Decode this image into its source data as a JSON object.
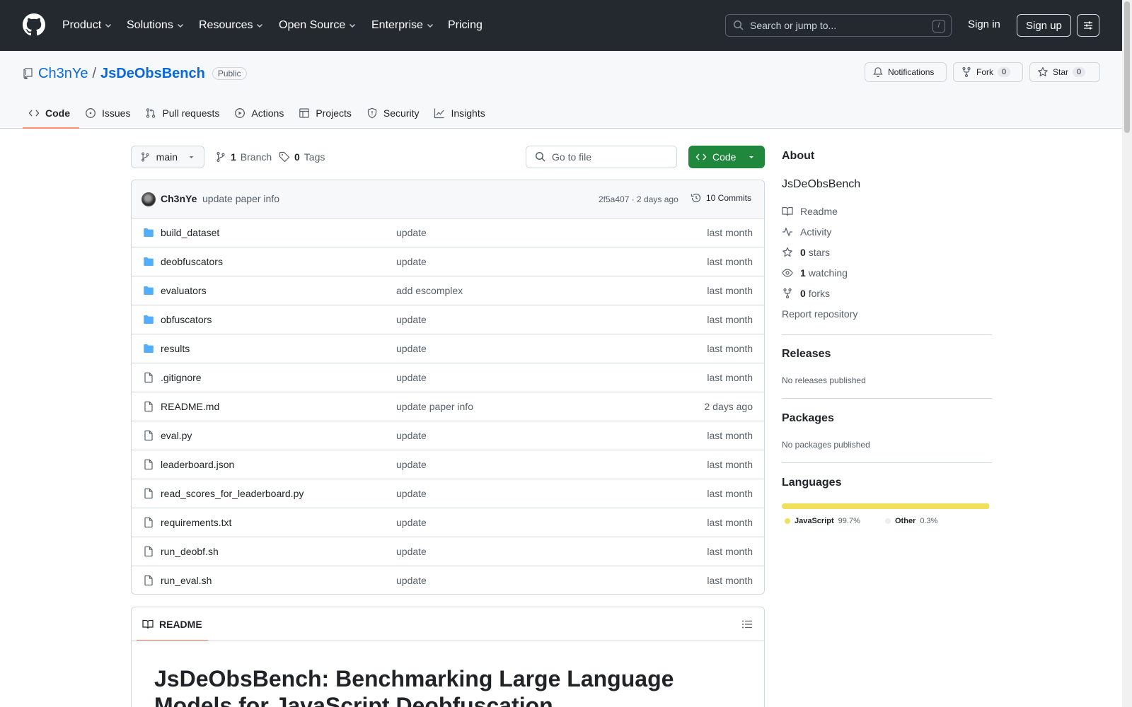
{
  "header": {
    "nav": [
      "Product",
      "Solutions",
      "Resources",
      "Open Source",
      "Enterprise",
      "Pricing"
    ],
    "search_placeholder": "Search or jump to...",
    "search_shortcut": "/",
    "sign_in": "Sign in",
    "sign_up": "Sign up"
  },
  "repo": {
    "owner": "Ch3nYe",
    "separator": "/",
    "name": "JsDeObsBench",
    "visibility": "Public",
    "notifications_label": "Notifications",
    "fork_label": "Fork",
    "fork_count": "0",
    "star_label": "Star",
    "star_count": "0"
  },
  "tabs": [
    "Code",
    "Issues",
    "Pull requests",
    "Actions",
    "Projects",
    "Security",
    "Insights"
  ],
  "toolbar": {
    "branch": "main",
    "branch_count": "1",
    "branch_label": "Branch",
    "tag_count": "0",
    "tag_label": "Tags",
    "goto_placeholder": "Go to file",
    "code_button": "Code"
  },
  "commit": {
    "author": "Ch3nYe",
    "message": "update paper info",
    "meta": "2f5a407 · 2 days ago",
    "commits": "10 Commits"
  },
  "files": [
    {
      "name": "build_dataset",
      "type": "folder",
      "message": "update",
      "time": "last month"
    },
    {
      "name": "deobfuscators",
      "type": "folder",
      "message": "update",
      "time": "last month"
    },
    {
      "name": "evaluators",
      "type": "folder",
      "message": "add escomplex",
      "time": "last month"
    },
    {
      "name": "obfuscators",
      "type": "folder",
      "message": "update",
      "time": "last month"
    },
    {
      "name": "results",
      "type": "folder",
      "message": "update",
      "time": "last month"
    },
    {
      "name": ".gitignore",
      "type": "file",
      "message": "update",
      "time": "last month"
    },
    {
      "name": "README.md",
      "type": "file",
      "message": "update paper info",
      "time": "2 days ago"
    },
    {
      "name": "eval.py",
      "type": "file",
      "message": "update",
      "time": "last month"
    },
    {
      "name": "leaderboard.json",
      "type": "file",
      "message": "update",
      "time": "last month"
    },
    {
      "name": "read_scores_for_leaderboard.py",
      "type": "file",
      "message": "update",
      "time": "last month"
    },
    {
      "name": "requirements.txt",
      "type": "file",
      "message": "update",
      "time": "last month"
    },
    {
      "name": "run_deobf.sh",
      "type": "file",
      "message": "update",
      "time": "last month"
    },
    {
      "name": "run_eval.sh",
      "type": "file",
      "message": "update",
      "time": "last month"
    }
  ],
  "readme": {
    "tab_label": "README",
    "heading": "JsDeObsBench: Benchmarking Large Language Models for JavaScript Deobfuscation"
  },
  "sidebar": {
    "about_title": "About",
    "description": "JsDeObsBench",
    "readme": "Readme",
    "activity": "Activity",
    "stars_count": "0",
    "stars_label": "stars",
    "watching_count": "1",
    "watching_label": "watching",
    "forks_count": "0",
    "forks_label": "forks",
    "report": "Report repository",
    "releases_title": "Releases",
    "releases_empty": "No releases published",
    "packages_title": "Packages",
    "packages_empty": "No packages published",
    "languages_title": "Languages",
    "languages": [
      {
        "name": "JavaScript",
        "percent": "99.7%",
        "share": 0.997,
        "color": "#f1e05a"
      },
      {
        "name": "Other",
        "percent": "0.3%",
        "share": 0.003,
        "color": "#ededed"
      }
    ]
  }
}
